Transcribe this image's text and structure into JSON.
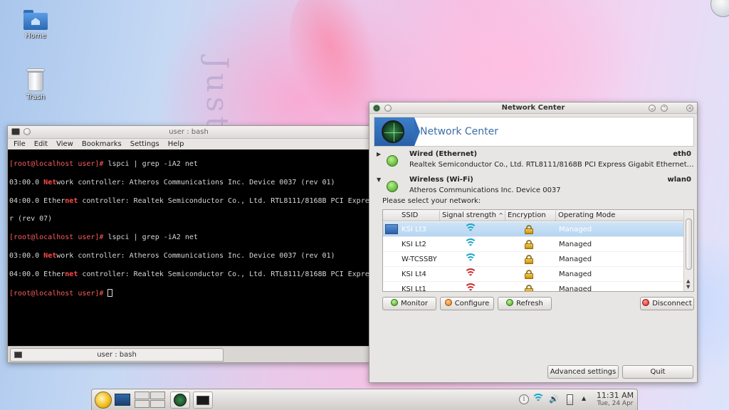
{
  "desktop": {
    "icons": [
      {
        "label": "Home",
        "icon": "folder-home-icon"
      },
      {
        "label": "Trash",
        "icon": "trash-icon"
      }
    ]
  },
  "terminal": {
    "title": "user : bash",
    "menu": [
      "File",
      "Edit",
      "View",
      "Bookmarks",
      "Settings",
      "Help"
    ],
    "tab_label": "user : bash",
    "lines": [
      {
        "prompt": "[root@localhost user]#",
        "text": " lspci | grep -iA2 net"
      },
      {
        "pre": "03:00.0 ",
        "hl": "Net",
        "post": "work controller: Atheros Communications Inc. Device 0037 (rev 01)"
      },
      {
        "pre": "04:00.0 Ether",
        "hl": "net",
        "post": " controller: Realtek Semiconductor Co., Ltd. RTL8111/8168B PCI Expre"
      },
      {
        "pre": "r (rev 07)",
        "hl": "",
        "post": ""
      },
      {
        "prompt": "[root@localhost user]#",
        "text": " lspci | grep -iA2 net"
      },
      {
        "pre": "03:00.0 ",
        "hl": "Net",
        "post": "work controller: Atheros Communications Inc. Device 0037 (rev 01)"
      },
      {
        "pre": "04:00.0 Ether",
        "hl": "net",
        "post": " controller: Realtek Semiconductor Co., Ltd. RTL8111/8168B PCI Expre"
      },
      {
        "prompt": "[root@localhost user]#",
        "text": " "
      }
    ]
  },
  "netcenter": {
    "window_title": "Network Center",
    "header_title": "Network Center",
    "wired": {
      "name": "Wired (Ethernet)",
      "device": "eth0",
      "description": "Realtek Semiconductor Co., Ltd. RTL8111/8168B PCI Express Gigabit Ethernet co..."
    },
    "wireless": {
      "name": "Wireless (Wi-Fi)",
      "device": "wlan0",
      "description": "Atheros Communications Inc. Device 0037"
    },
    "select_label": "Please select your network:",
    "columns": [
      "SSID",
      "Signal strength",
      "Encryption",
      "Operating Mode"
    ],
    "sort_indicator": "^",
    "networks": [
      {
        "ssid": "KSI Lt3",
        "signal_color": "#1aa6c9",
        "mode": "Managed",
        "selected": true
      },
      {
        "ssid": "KSI Lt2",
        "signal_color": "#1aa6c9",
        "mode": "Managed",
        "selected": false
      },
      {
        "ssid": "W-TCSSBY",
        "signal_color": "#1aa6c9",
        "mode": "Managed",
        "selected": false
      },
      {
        "ssid": "KSI Lt4",
        "signal_color": "#cc2a2a",
        "mode": "Managed",
        "selected": false
      },
      {
        "ssid": "KSI Lt1",
        "signal_color": "#cc2a2a",
        "mode": "Managed",
        "selected": false
      }
    ],
    "buttons": {
      "monitor": "Monitor",
      "configure": "Configure",
      "refresh": "Refresh",
      "disconnect": "Disconnect",
      "advanced": "Advanced settings",
      "quit": "Quit"
    }
  },
  "panel": {
    "clock_time": "11:31 AM",
    "clock_date": "Tue, 24 Apr",
    "info_glyph": "i",
    "volume_glyph": "🔊",
    "caret_glyph": "▲"
  }
}
